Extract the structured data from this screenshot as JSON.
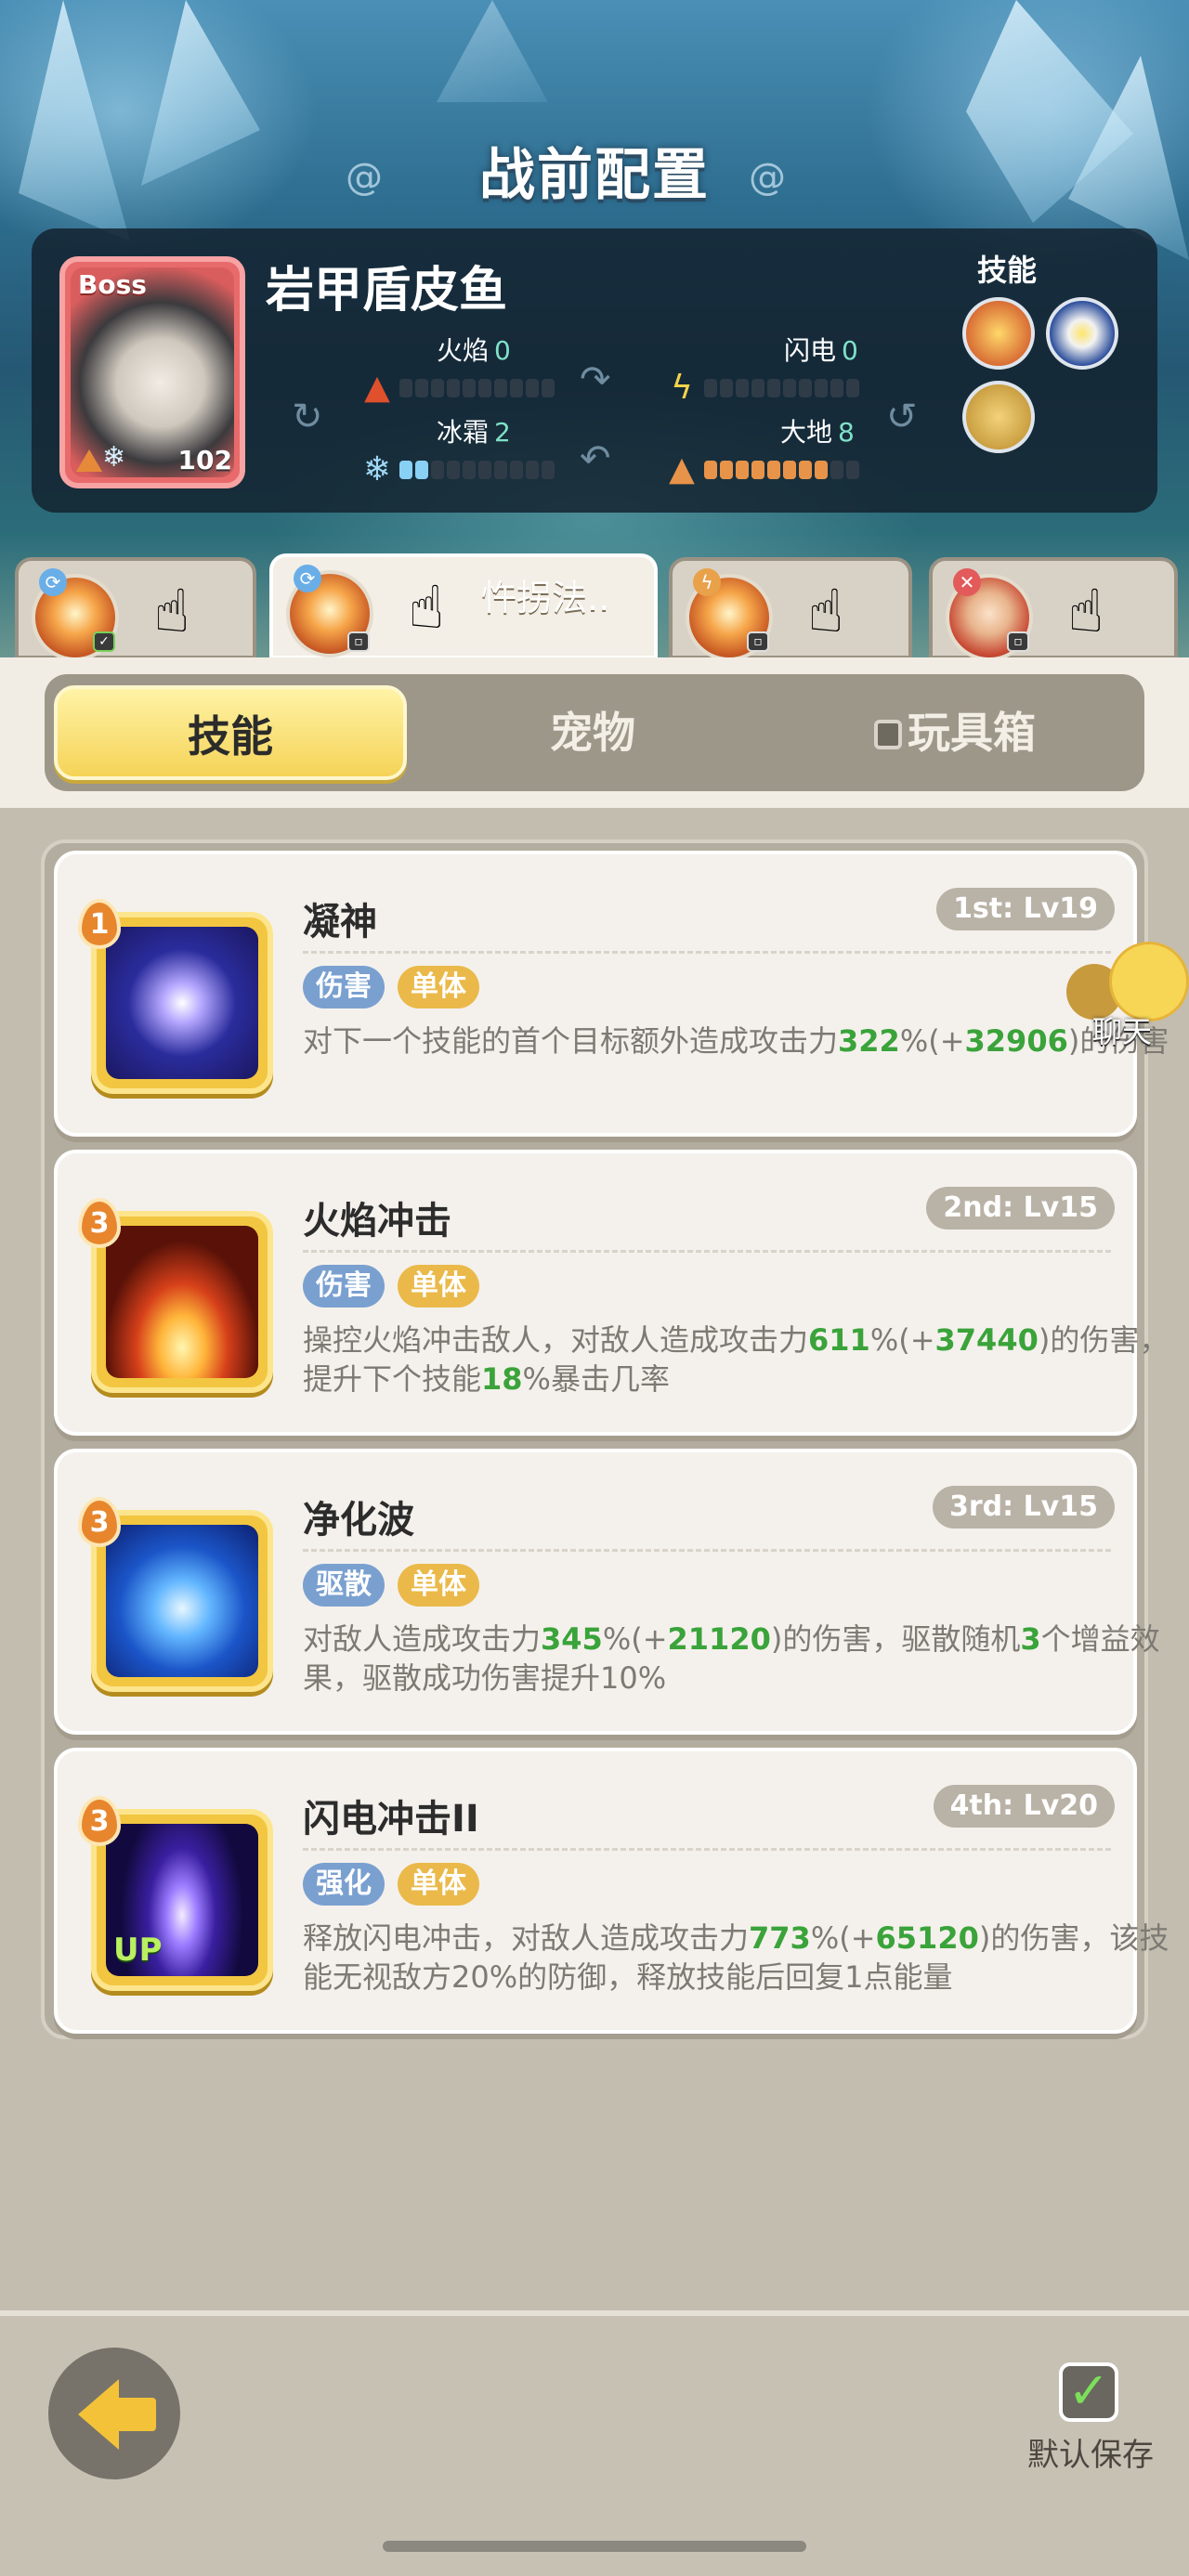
{
  "page_title": "战前配置",
  "boss": {
    "badge": "Boss",
    "level": "102",
    "name": "岩甲盾皮鱼",
    "elements": [
      {
        "label": "火焰",
        "value": "0",
        "fill": 0,
        "icon": "fire-icon"
      },
      {
        "label": "闪电",
        "value": "0",
        "fill": 0,
        "icon": "lightning-icon"
      },
      {
        "label": "冰霜",
        "value": "2",
        "fill": 2,
        "icon": "snowflake-icon"
      },
      {
        "label": "大地",
        "value": "8",
        "fill": 8,
        "icon": "earth-icon"
      }
    ],
    "skills_label": "技能"
  },
  "characters": [
    {
      "name": "",
      "icon": "fire-hero-portrait",
      "active": false
    },
    {
      "name": "忤拐法..",
      "icon": "fire-hero-portrait",
      "active": true
    },
    {
      "name": "",
      "icon": "fire-hero-portrait",
      "active": false
    },
    {
      "name": "",
      "icon": "red-hair-hero-portrait",
      "active": false
    }
  ],
  "tabs": {
    "skills": "技能",
    "pets": "宠物",
    "toybox": "玩具箱"
  },
  "chat_label": "聊天",
  "skills": [
    {
      "order": "1",
      "name": "凝神",
      "level": "1st: Lv19",
      "tags": [
        "伤害",
        "单体"
      ],
      "desc": [
        {
          "t": "对下一个技能的首个目标额外造成攻击力"
        },
        {
          "t": "322",
          "g": true
        },
        {
          "t": "%(+"
        },
        {
          "t": "32906",
          "g": true
        },
        {
          "t": ")的伤害"
        }
      ],
      "icon": "eye-icon"
    },
    {
      "order": "3",
      "name": "火焰冲击",
      "level": "2nd: Lv15",
      "tags": [
        "伤害",
        "单体"
      ],
      "desc": [
        {
          "t": "操控火焰冲击敌人，对敌人造成攻击力"
        },
        {
          "t": "611",
          "g": true
        },
        {
          "t": "%(+"
        },
        {
          "t": "37440",
          "g": true
        },
        {
          "t": ")的伤害，提升下个技能"
        },
        {
          "t": "18",
          "g": true
        },
        {
          "t": "%暴击几率"
        }
      ],
      "icon": "flame-burst-icon"
    },
    {
      "order": "3",
      "name": "净化波",
      "level": "3rd: Lv15",
      "tags": [
        "驱散",
        "单体"
      ],
      "desc": [
        {
          "t": "对敌人造成攻击力"
        },
        {
          "t": "345",
          "g": true
        },
        {
          "t": "%(+"
        },
        {
          "t": "21120",
          "g": true
        },
        {
          "t": ")的伤害，驱散随机"
        },
        {
          "t": "3",
          "g": true
        },
        {
          "t": "个增益效果，驱散成功伤害提升10%"
        }
      ],
      "icon": "water-swirl-icon"
    },
    {
      "order": "3",
      "name": "闪电冲击II",
      "level": "4th: Lv20",
      "tags": [
        "强化",
        "单体"
      ],
      "desc": [
        {
          "t": "释放闪电冲击，对敌人造成攻击力"
        },
        {
          "t": "773",
          "g": true
        },
        {
          "t": "%(+"
        },
        {
          "t": "65120",
          "g": true
        },
        {
          "t": ")的伤害，该技能无视敌方20%的防御，释放技能后回复1点能量"
        }
      ],
      "icon": "lightning-strike-icon",
      "badge": "UP"
    }
  ],
  "save_label": "默认保存",
  "colors": {
    "highlight_green": "#3aa33a",
    "active_tab": "#f5d357",
    "boss_card": "#e86a6a"
  }
}
